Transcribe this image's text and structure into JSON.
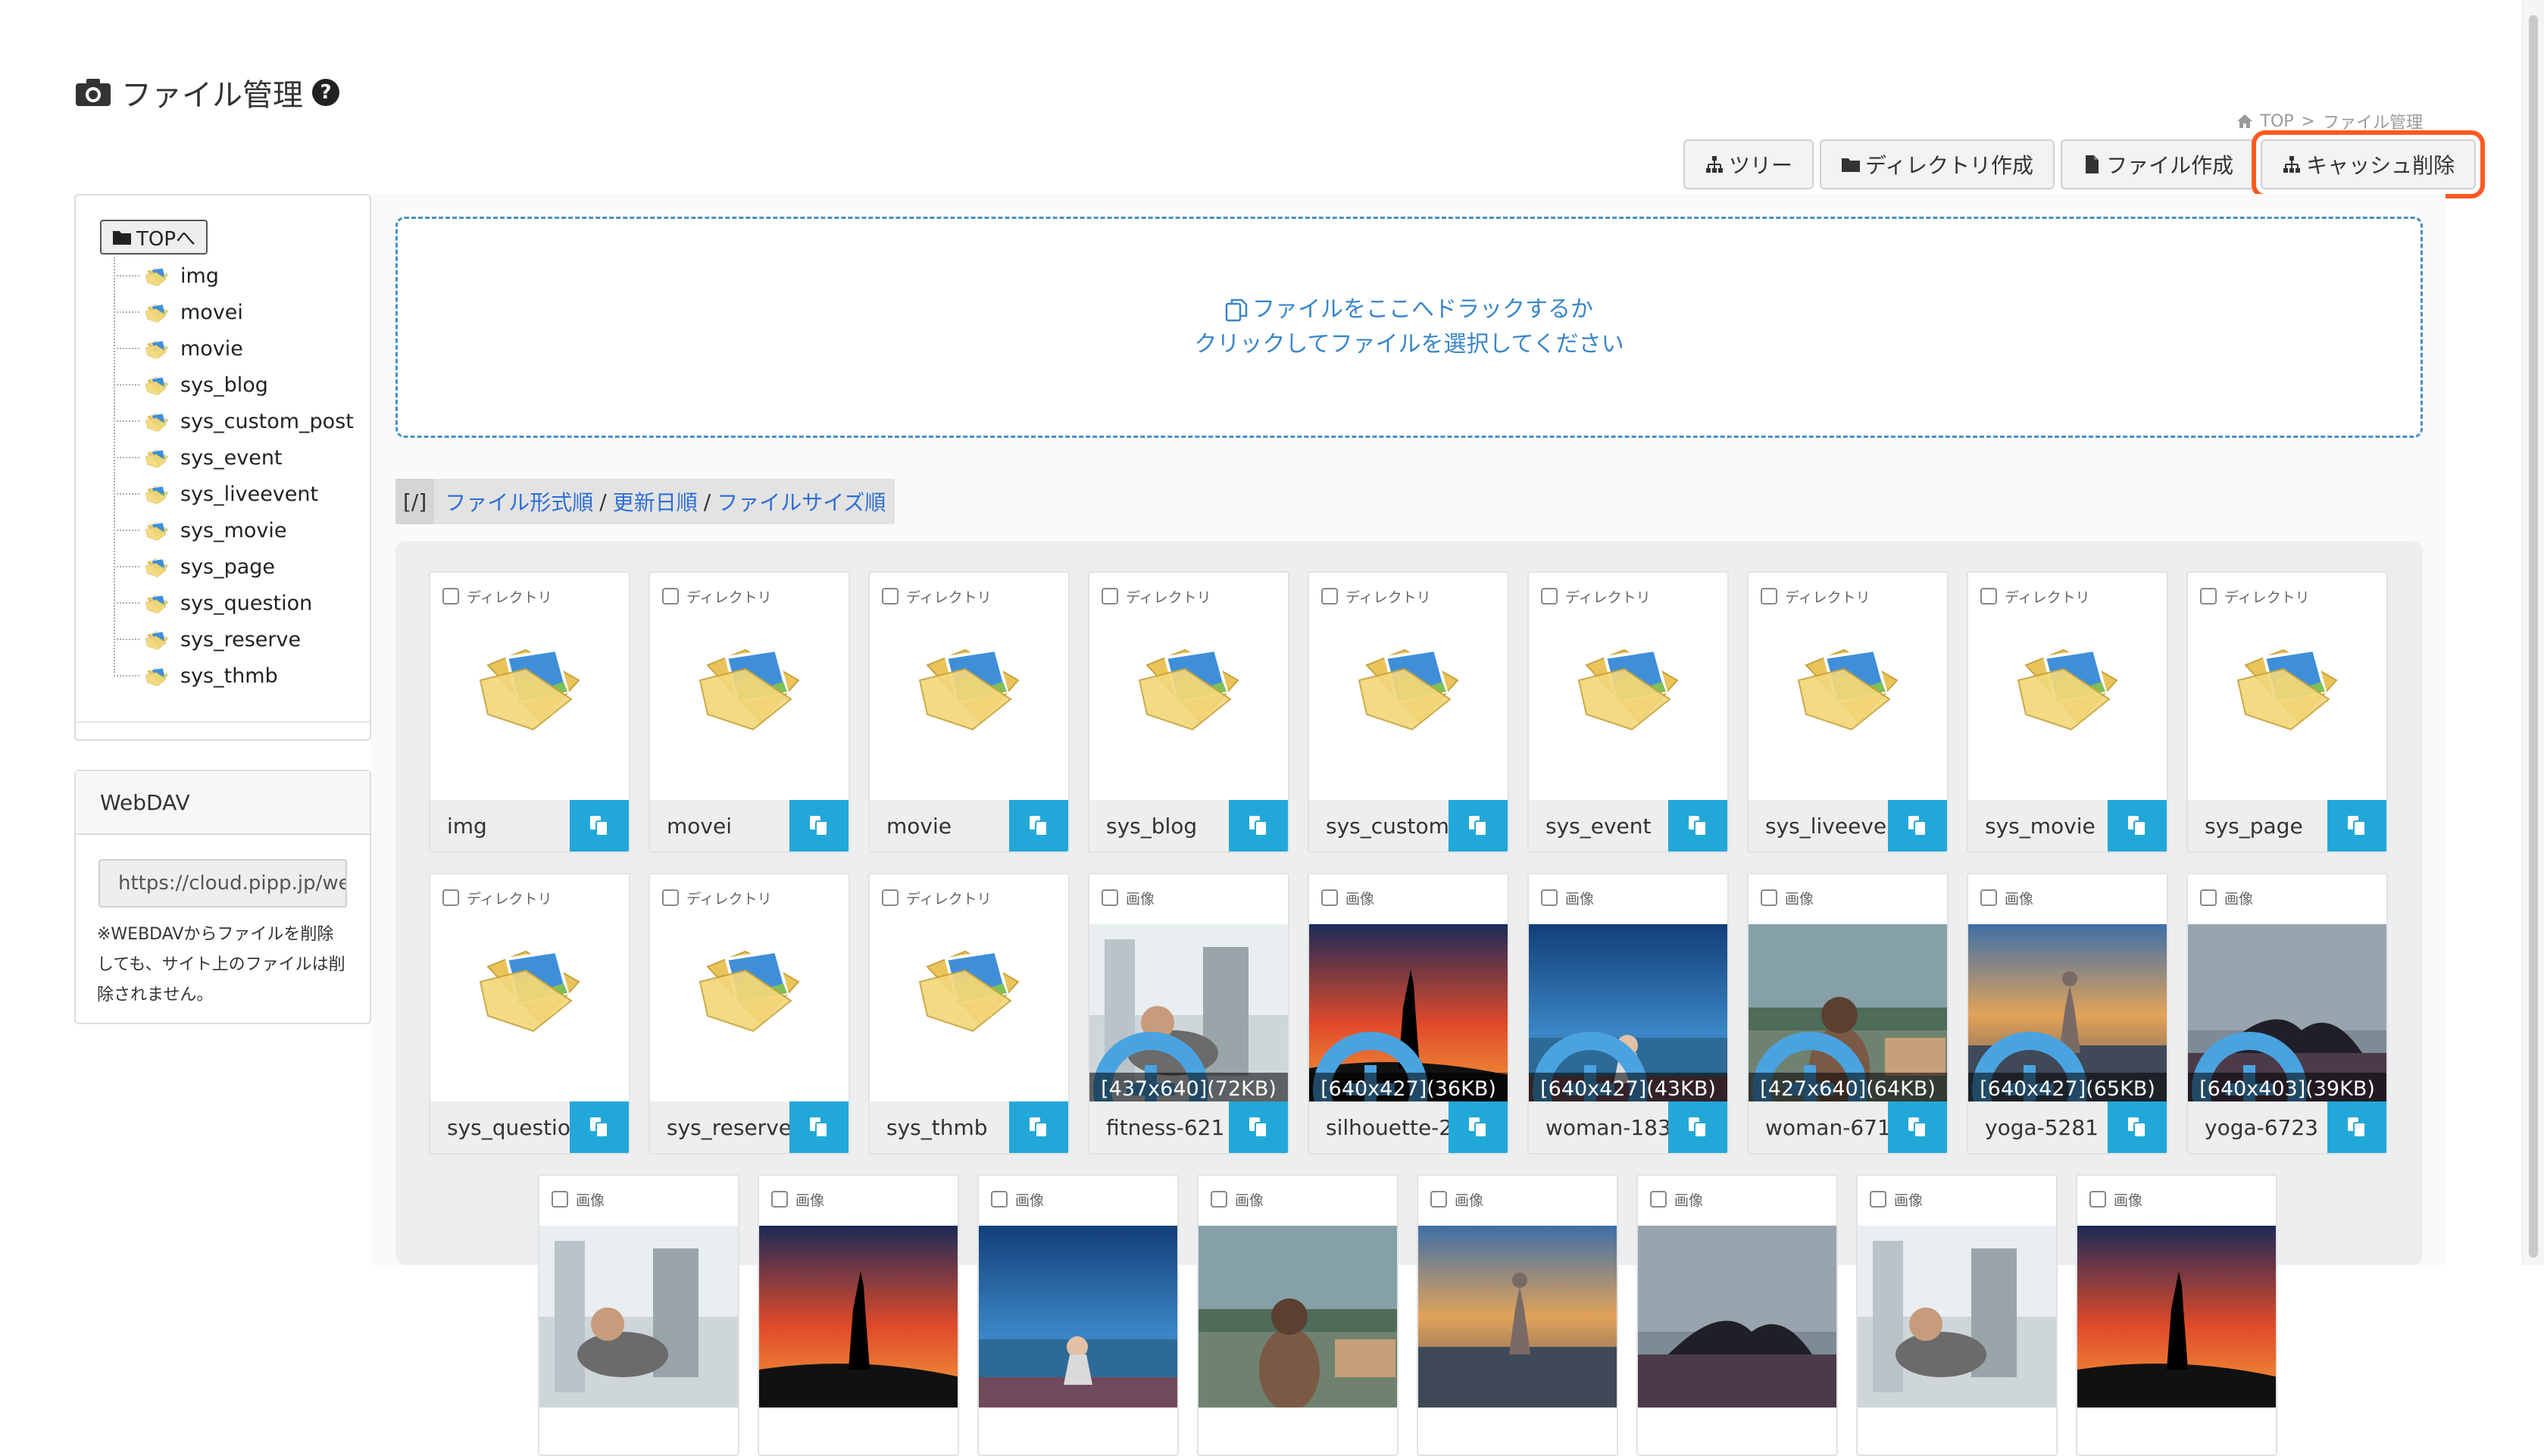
{
  "header": {
    "title": "ファイル管理",
    "help_symbol": "?"
  },
  "breadcrumb": {
    "home": "TOP",
    "separator": ">",
    "current": "ファイル管理"
  },
  "toolbar": {
    "tree": "ツリー",
    "mkdir": "ディレクトリ作成",
    "mkfile": "ファイル作成",
    "clear_cache": "キャッシュ削除",
    "highlight_color": "#ff5a1f"
  },
  "sidebar": {
    "top_button": "TOPへ",
    "tree": [
      {
        "label": "img"
      },
      {
        "label": "movei"
      },
      {
        "label": "movie"
      },
      {
        "label": "sys_blog"
      },
      {
        "label": "sys_custom_post"
      },
      {
        "label": "sys_event"
      },
      {
        "label": "sys_liveevent"
      },
      {
        "label": "sys_movie"
      },
      {
        "label": "sys_page"
      },
      {
        "label": "sys_question"
      },
      {
        "label": "sys_reserve"
      },
      {
        "label": "sys_thmb"
      }
    ]
  },
  "webdav": {
    "title": "WebDAV",
    "url": "https://cloud.pipp.jp/webdav",
    "note": "※WEBDAVからファイルを削除しても、サイト上のファイルは削除されません。"
  },
  "dropzone": {
    "line1": "ファイルをここへドラックするか",
    "line2": "クリックしてファイルを選択してください"
  },
  "sort": {
    "path": "[/]",
    "by_type": "ファイル形式順",
    "by_date": "更新日順",
    "by_size": "ファイルサイズ順",
    "sep": "/"
  },
  "grid": {
    "row1": [
      {
        "type": "ディレクトリ",
        "name": "img"
      },
      {
        "type": "ディレクトリ",
        "name": "movei"
      },
      {
        "type": "ディレクトリ",
        "name": "movie"
      },
      {
        "type": "ディレクトリ",
        "name": "sys_blog"
      },
      {
        "type": "ディレクトリ",
        "name": "sys_custom_post"
      },
      {
        "type": "ディレクトリ",
        "name": "sys_event"
      },
      {
        "type": "ディレクトリ",
        "name": "sys_liveevent"
      },
      {
        "type": "ディレクトリ",
        "name": "sys_movie"
      },
      {
        "type": "ディレクトリ",
        "name": "sys_page"
      }
    ],
    "row2": [
      {
        "type": "ディレクトリ",
        "name": "sys_question"
      },
      {
        "type": "ディレクトリ",
        "name": "sys_reserve"
      },
      {
        "type": "ディレクトリ",
        "name": "sys_thmb"
      },
      {
        "type": "画像",
        "name": "fitness-621",
        "dims": "[437x640](72KB)"
      },
      {
        "type": "画像",
        "name": "silhouette-2",
        "dims": "[640x427](36KB)"
      },
      {
        "type": "画像",
        "name": "woman-183",
        "dims": "[640x427](43KB)"
      },
      {
        "type": "画像",
        "name": "woman-671",
        "dims": "[427x640](64KB)"
      },
      {
        "type": "画像",
        "name": "yoga-5281",
        "dims": "[640x427](65KB)"
      },
      {
        "type": "画像",
        "name": "yoga-6723",
        "dims": "[640x403](39KB)"
      }
    ],
    "row3": [
      {
        "type": "画像"
      },
      {
        "type": "画像"
      },
      {
        "type": "画像"
      },
      {
        "type": "画像"
      },
      {
        "type": "画像"
      },
      {
        "type": "画像"
      },
      {
        "type": "画像"
      },
      {
        "type": "画像"
      }
    ]
  },
  "colors": {
    "accent_copy": "#22a8d8",
    "link": "#2f6fd6",
    "dropzone": "#3a86c8"
  }
}
